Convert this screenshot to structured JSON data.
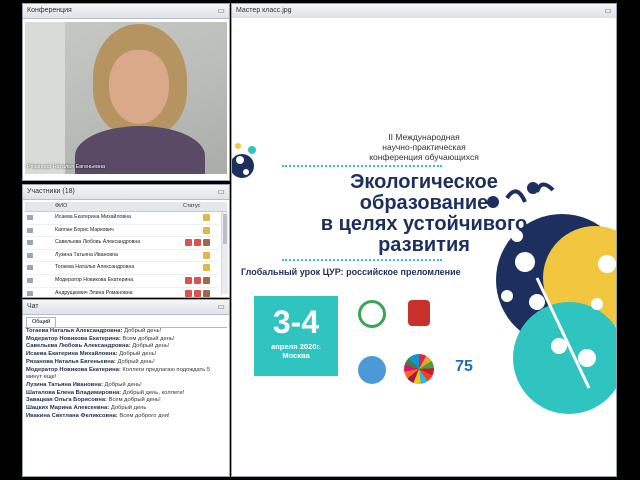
{
  "conference": {
    "title": "Конференция",
    "video_caption": "Рязанова Наталья Евгеньевна"
  },
  "slide_window": {
    "title": "Мастер класс.jpg"
  },
  "participants": {
    "title": "Участники (18)",
    "col_name": "ФИО",
    "col_status": "Статус",
    "rows": [
      {
        "name": "Исаева Екатерина Михайловна",
        "status": "hand"
      },
      {
        "name": "Каплан Борис Маркович",
        "status": "hand"
      },
      {
        "name": "Савельева Любовь Александровна",
        "status": "full"
      },
      {
        "name": "Лузина Татьяна Ивановна",
        "status": "hand"
      },
      {
        "name": "Тогаева Наталья Александровна",
        "status": "hand"
      },
      {
        "name": "Модератор Новикова Екатерина",
        "status": "full"
      },
      {
        "name": "Андрущкевич Элина Романовна",
        "status": "full"
      }
    ]
  },
  "chat": {
    "title": "Чат",
    "tab": "Общий",
    "messages": [
      {
        "sender": "Тогаева Наталья Александровна:",
        "text": " Добрый день!"
      },
      {
        "sender": "Модератор Новикова Екатерина:",
        "text": " Всем добрый день!"
      },
      {
        "sender": "Савельева Любовь Александровна:",
        "text": " Добрый день!"
      },
      {
        "sender": "Исаева Екатерина Михайловна:",
        "text": " Добрый день!"
      },
      {
        "sender": "Рязанова Наталья Евгеньевна:",
        "text": " Добрый день!"
      },
      {
        "sender": "Модератор Новикова Екатерина:",
        "text": " Коллеги предлагаю подождать 5"
      },
      {
        "sender": "",
        "text": "минут еще!"
      },
      {
        "sender": "Лузина Татьяна Ивановна:",
        "text": " Добрый день!"
      },
      {
        "sender": "Шаталова Елена Владимировна:",
        "text": " Добрый день, коллеги!"
      },
      {
        "sender": "Завацкая Ольга Борисовна:",
        "text": " Всем добрый день!"
      },
      {
        "sender": "Шацких Марина Алексеевна:",
        "text": " Добрый день"
      },
      {
        "sender": "Ивакина Светлана Феликсовна:",
        "text": " Всем доброго дня!"
      }
    ]
  },
  "poster": {
    "line1": "II Международная",
    "line2": "научно-практическая",
    "line3": "конференция обучающихся",
    "title1": "Экологическое",
    "title2": "образование",
    "title3": "в целях устойчивого",
    "title4": "развития",
    "subtitle": "Глобальный урок ЦУР: российское преломление",
    "dates": "3-4",
    "month": "апреля 2020г.",
    "city": "Москва",
    "un75": "75",
    "accent": "#2fc4c0",
    "navy": "#1c2f5e",
    "yellow": "#f3c63f"
  }
}
